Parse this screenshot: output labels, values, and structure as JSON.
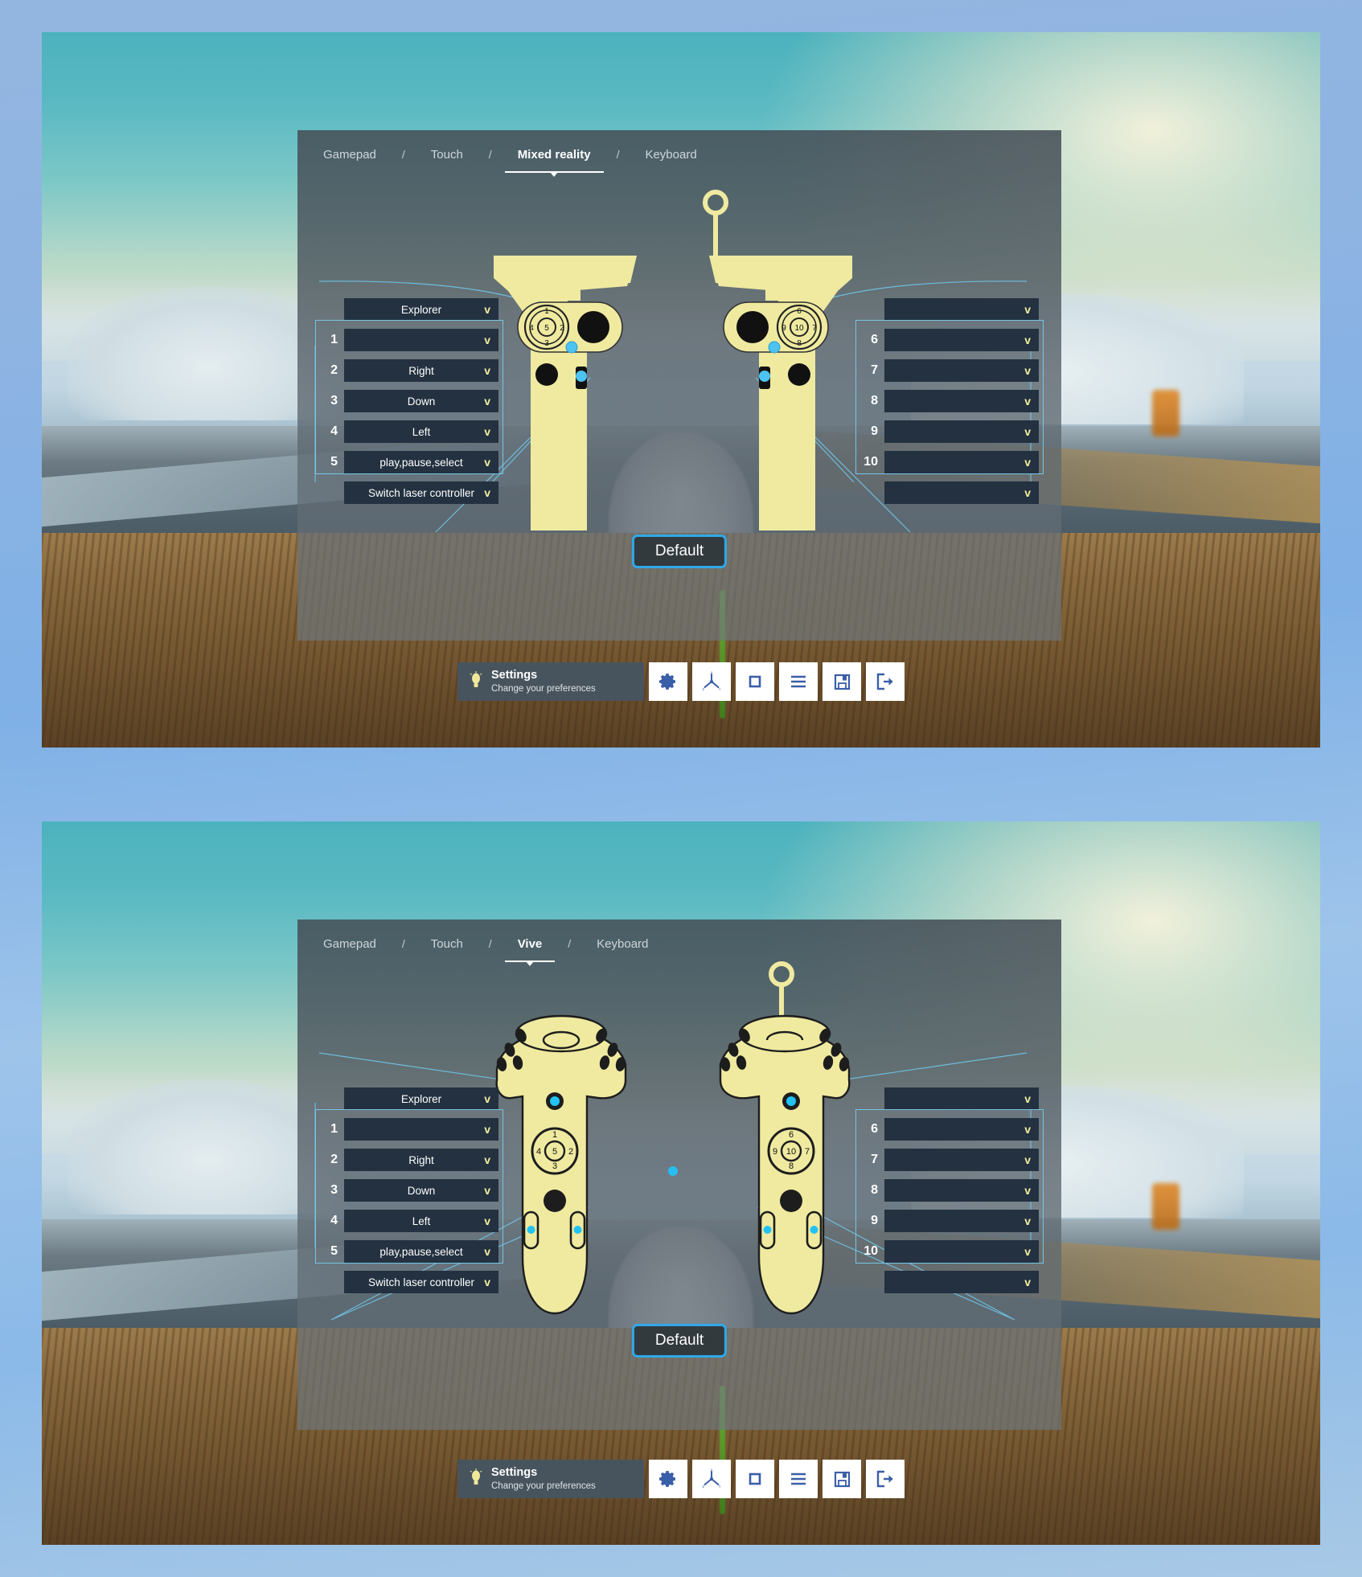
{
  "colors": {
    "accent_cyan": "#2fa9e8",
    "group_outline": "#76c4e6",
    "dropdown_bg": "#233140",
    "chevron": "#f2efa0",
    "controller_yellow": "#efeaa0",
    "toolbar_icon": "#3b5ea8",
    "panel_bg": "#4e5860"
  },
  "screenshots": [
    {
      "id": "shot-1",
      "tabs": [
        {
          "label": "Gamepad",
          "active": false
        },
        {
          "label": "Touch",
          "active": false
        },
        {
          "label": "Mixed reality",
          "active": true
        },
        {
          "label": "Keyboard",
          "active": false
        }
      ],
      "separator": "/",
      "controller_type": "mixed-reality",
      "left_column": {
        "top_dropdown": {
          "label": "Explorer",
          "chevron": "v"
        },
        "rows": [
          {
            "index": "1",
            "label": "",
            "chevron": "v"
          },
          {
            "index": "2",
            "label": "Right",
            "chevron": "v"
          },
          {
            "index": "3",
            "label": "Down",
            "chevron": "v"
          },
          {
            "index": "4",
            "label": "Left",
            "chevron": "v"
          },
          {
            "index": "5",
            "label": "play,pause,select",
            "chevron": "v"
          }
        ],
        "bottom_dropdown": {
          "label": "Switch laser controller",
          "chevron": "v"
        }
      },
      "right_column": {
        "top_dropdown": {
          "label": "",
          "chevron": "v"
        },
        "rows": [
          {
            "index": "6",
            "label": "",
            "chevron": "v"
          },
          {
            "index": "7",
            "label": "",
            "chevron": "v"
          },
          {
            "index": "8",
            "label": "",
            "chevron": "v"
          },
          {
            "index": "9",
            "label": "",
            "chevron": "v"
          },
          {
            "index": "10",
            "label": "",
            "chevron": "v"
          }
        ],
        "bottom_dropdown": {
          "label": "",
          "chevron": "v"
        }
      },
      "touchpad_numbers": {
        "left": {
          "up": "1",
          "right": "2",
          "down": "3",
          "left": "4",
          "center": "5"
        },
        "right": {
          "up": "6",
          "right": "7",
          "down": "8",
          "left": "9",
          "center": "10"
        }
      },
      "default_button": "Default",
      "toolbar": {
        "settings_title": "Settings",
        "settings_subtitle": "Change your preferences",
        "bulb_icon": "lightbulb-icon",
        "buttons": [
          {
            "icon": "gear-icon",
            "name": "preferences-button"
          },
          {
            "icon": "axis-xyz-icon",
            "name": "axis-button"
          },
          {
            "icon": "square-icon",
            "name": "display-button"
          },
          {
            "icon": "hamburger-menu-icon",
            "name": "menu-button"
          },
          {
            "icon": "floppy-save-icon",
            "name": "save-button"
          },
          {
            "icon": "exit-arrow-icon",
            "name": "exit-button"
          }
        ]
      }
    },
    {
      "id": "shot-2",
      "tabs": [
        {
          "label": "Gamepad",
          "active": false
        },
        {
          "label": "Touch",
          "active": false
        },
        {
          "label": "Vive",
          "active": true
        },
        {
          "label": "Keyboard",
          "active": false
        }
      ],
      "separator": "/",
      "controller_type": "vive",
      "left_column": {
        "top_dropdown": {
          "label": "Explorer",
          "chevron": "v"
        },
        "rows": [
          {
            "index": "1",
            "label": "",
            "chevron": "v"
          },
          {
            "index": "2",
            "label": "Right",
            "chevron": "v"
          },
          {
            "index": "3",
            "label": "Down",
            "chevron": "v"
          },
          {
            "index": "4",
            "label": "Left",
            "chevron": "v"
          },
          {
            "index": "5",
            "label": "play,pause,select",
            "chevron": "v"
          }
        ],
        "bottom_dropdown": {
          "label": "Switch laser controller",
          "chevron": "v"
        }
      },
      "right_column": {
        "top_dropdown": {
          "label": "",
          "chevron": "v"
        },
        "rows": [
          {
            "index": "6",
            "label": "",
            "chevron": "v"
          },
          {
            "index": "7",
            "label": "",
            "chevron": "v"
          },
          {
            "index": "8",
            "label": "",
            "chevron": "v"
          },
          {
            "index": "9",
            "label": "",
            "chevron": "v"
          },
          {
            "index": "10",
            "label": "",
            "chevron": "v"
          }
        ],
        "bottom_dropdown": {
          "label": "",
          "chevron": "v"
        }
      },
      "touchpad_numbers": {
        "left": {
          "up": "1",
          "right": "2",
          "down": "3",
          "left": "4",
          "center": "5"
        },
        "right": {
          "up": "6",
          "right": "7",
          "down": "8",
          "left": "9",
          "center": "10"
        }
      },
      "default_button": "Default",
      "toolbar": {
        "settings_title": "Settings",
        "settings_subtitle": "Change your preferences",
        "bulb_icon": "lightbulb-icon",
        "buttons": [
          {
            "icon": "gear-icon",
            "name": "preferences-button"
          },
          {
            "icon": "axis-xyz-icon",
            "name": "axis-button"
          },
          {
            "icon": "square-icon",
            "name": "display-button"
          },
          {
            "icon": "hamburger-menu-icon",
            "name": "menu-button"
          },
          {
            "icon": "floppy-save-icon",
            "name": "save-button"
          },
          {
            "icon": "exit-arrow-icon",
            "name": "exit-button"
          }
        ]
      }
    }
  ]
}
